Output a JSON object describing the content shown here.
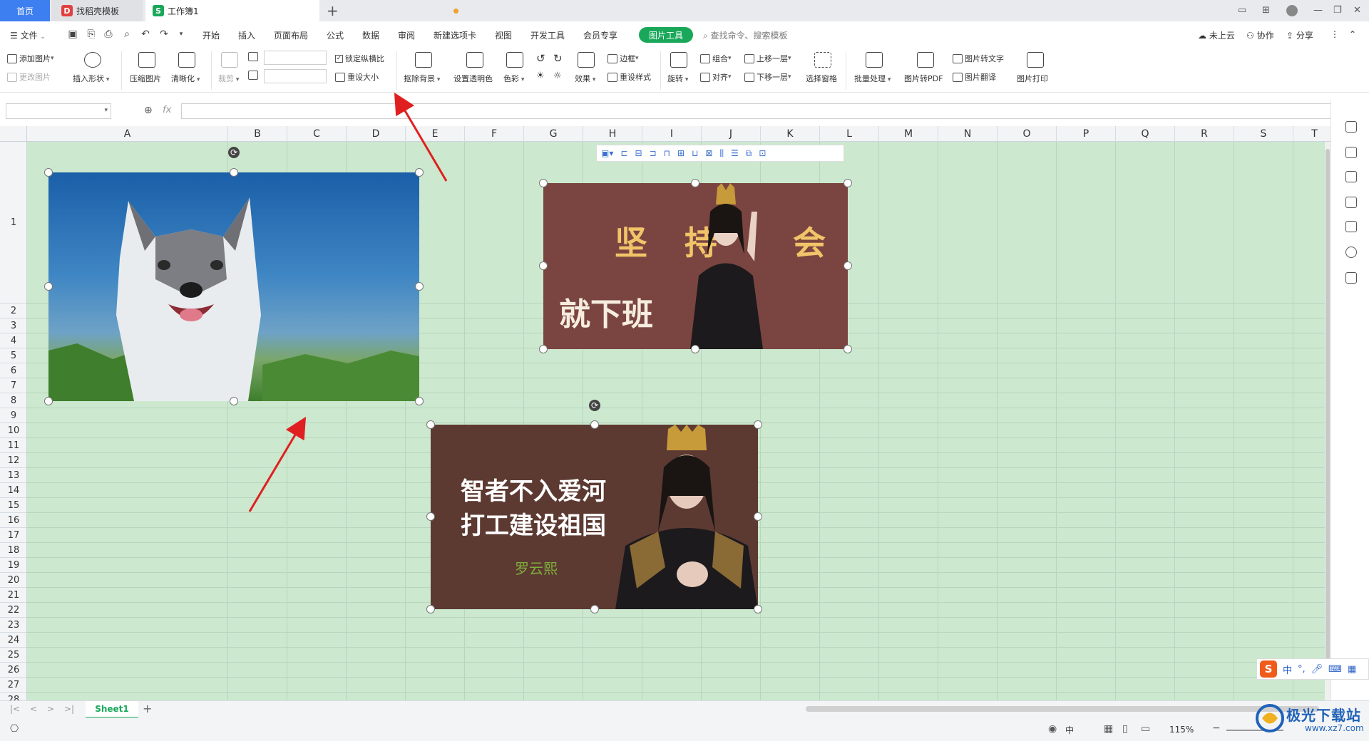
{
  "tabs": {
    "home": "首页",
    "template": "找稻壳模板",
    "workbook": "工作簿1"
  },
  "menu": {
    "file": "文件",
    "items": [
      "开始",
      "插入",
      "页面布局",
      "公式",
      "数据",
      "审阅",
      "新建选项卡",
      "视图",
      "开发工具",
      "会员专享"
    ],
    "picture_tools": "图片工具",
    "search_placeholder": "查找命令、搜索模板",
    "cloud": "未上云",
    "collab": "协作",
    "share": "分享"
  },
  "ribbon": {
    "add_picture": "添加图片",
    "change_picture": "更改图片",
    "insert_shape": "插入形状",
    "compress": "压缩图片",
    "sharpen": "清晰化",
    "crop": "裁剪",
    "lock_ratio": "锁定纵横比",
    "reset_size": "重设大小",
    "remove_bg": "抠除背景",
    "set_transparent": "设置透明色",
    "color": "色彩",
    "effects": "效果",
    "border": "边框",
    "reset_style": "重设样式",
    "rotate": "旋转",
    "group": "组合",
    "align": "对齐",
    "bring_forward": "上移一层",
    "send_backward": "下移一层",
    "selection_pane": "选择窗格",
    "batch": "批量处理",
    "to_pdf": "图片转PDF",
    "to_text": "图片转文字",
    "translate": "图片翻译",
    "print": "图片打印"
  },
  "formula": {
    "fx": "fx",
    "name_value": "",
    "formula_value": ""
  },
  "grid": {
    "columns": [
      "A",
      "B",
      "C",
      "D",
      "E",
      "F",
      "G",
      "H",
      "I",
      "J",
      "K",
      "L",
      "M",
      "N",
      "O",
      "P",
      "Q",
      "R",
      "S",
      "T"
    ],
    "rows": [
      "1",
      "2",
      "3",
      "4",
      "5",
      "6",
      "7",
      "8",
      "9",
      "10",
      "11",
      "12",
      "13",
      "14",
      "15",
      "16",
      "17",
      "18",
      "19",
      "20",
      "21",
      "22",
      "23",
      "24",
      "25",
      "26",
      "27",
      "28"
    ],
    "cell_bg": "#cce8cf"
  },
  "pictures": {
    "pic2": {
      "line1": "坚 持",
      "line1b": "会",
      "line2": "就下班"
    },
    "pic3": {
      "line1": "智者不入爱河",
      "line2": "打工建设祖国",
      "signature": "罗云熙"
    }
  },
  "sheets": {
    "tabs": [
      "Sheet1"
    ],
    "add": "+"
  },
  "status": {
    "input_mode": "中",
    "zoom": "115%"
  },
  "ime": {
    "mode": "中",
    "punct": "°,"
  },
  "watermark": {
    "text": "极光下载站",
    "url": "www.xz7.com"
  },
  "colors": {
    "accent": "#19a85a",
    "annotation_arrow": "#e02020",
    "home_tab": "#3d7ef0"
  }
}
